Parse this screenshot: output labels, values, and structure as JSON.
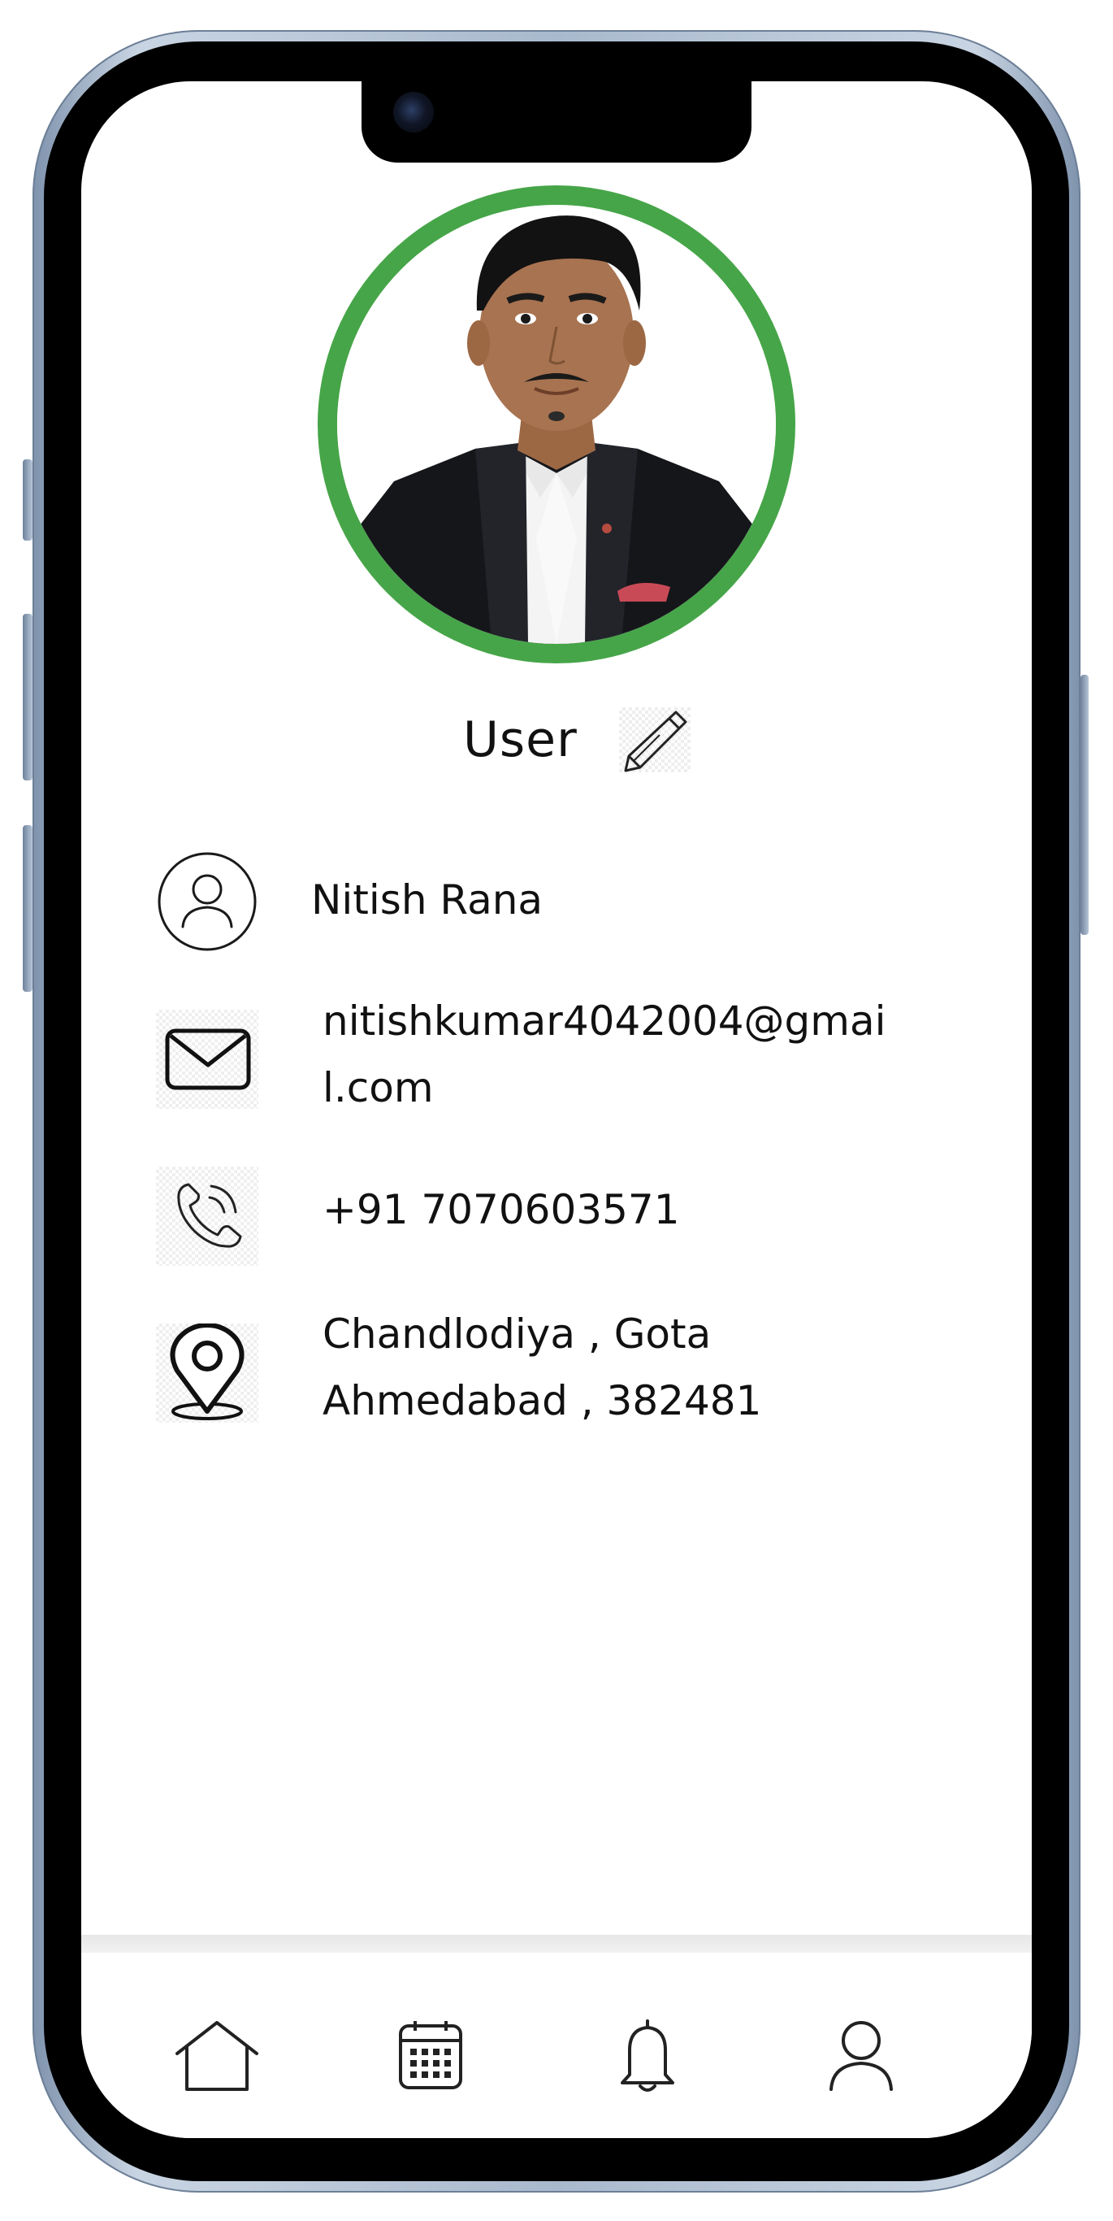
{
  "profile": {
    "title": "User",
    "avatar_ring_color": "#46a548",
    "avatar_icon": "user-photo",
    "edit_icon": "pencil-icon"
  },
  "info": {
    "name": {
      "icon": "person-circle-icon",
      "value": "Nitish Rana"
    },
    "email": {
      "icon": "mail-icon",
      "line1": "nitishkumar4042004@gmai",
      "line2": "l.com"
    },
    "phone": {
      "icon": "phone-call-icon",
      "value": "+91 7070603571"
    },
    "address": {
      "icon": "location-pin-icon",
      "line1": "Chandlodiya , Gota",
      "line2": "Ahmedabad , 382481"
    }
  },
  "bottom_nav": {
    "items": [
      {
        "icon": "home-icon"
      },
      {
        "icon": "calendar-icon"
      },
      {
        "icon": "bell-icon"
      },
      {
        "icon": "profile-icon"
      }
    ]
  }
}
